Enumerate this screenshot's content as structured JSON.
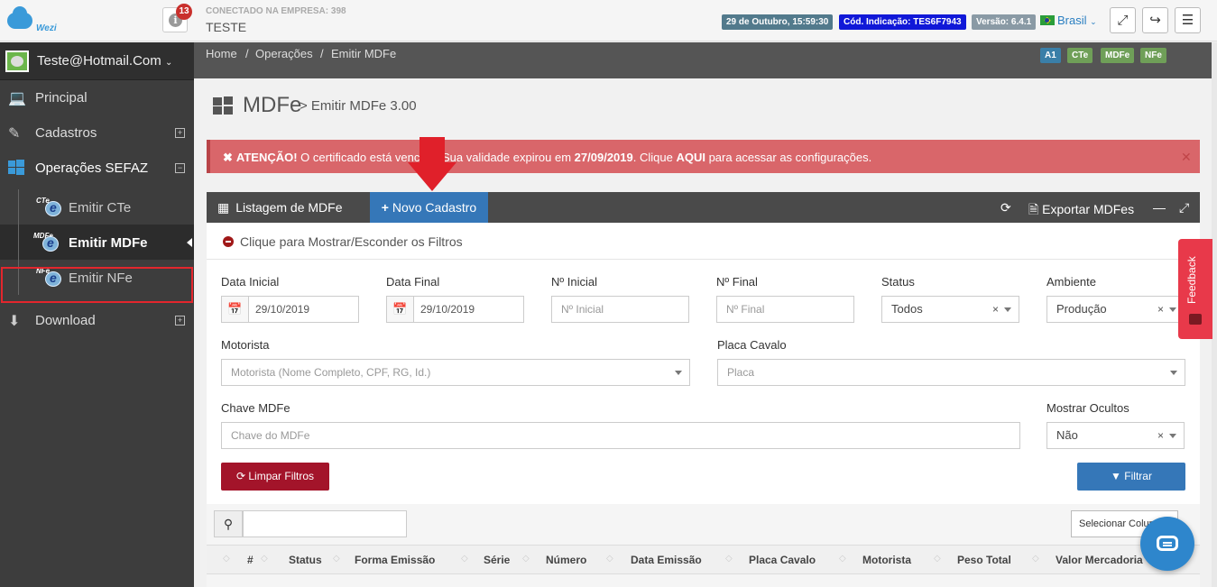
{
  "app": {
    "logo_text": "Wezi"
  },
  "topbar": {
    "notification_count": "13",
    "connected_label": "CONECTADO NA EMPRESA: 398",
    "company_name": "TESTE",
    "date_tag": "29 de Outubro, 15:59:30",
    "indication_tag": "Cód. Indicação: TES6F7943",
    "version_tag": "Versão: 6.4.1",
    "language": "Brasil",
    "icons": [
      "expand-icon",
      "logout-icon",
      "menu-icon"
    ]
  },
  "sidebar": {
    "user": "Teste@Hotmail.Com",
    "items": [
      {
        "label": "Principal",
        "icon": "laptop-icon"
      },
      {
        "label": "Cadastros",
        "icon": "edit-icon"
      },
      {
        "label": "Operações SEFAZ",
        "icon": "windows-icon"
      },
      {
        "label": "Download",
        "icon": "download-icon"
      }
    ],
    "sub_items": [
      {
        "label": "Emitir CTe",
        "tag": "CTe"
      },
      {
        "label": "Emitir MDFe",
        "tag": "MDFe"
      },
      {
        "label": "Emitir NFe",
        "tag": "NFe"
      }
    ]
  },
  "breadcrumb": {
    "items": [
      "Home",
      "Operações",
      "Emitir MDFe"
    ],
    "separator": "/",
    "badges": [
      {
        "label": "A1",
        "color": "#3a7fa8"
      },
      {
        "label": "CTe",
        "color": "#6f9f58"
      },
      {
        "label": "MDFe",
        "color": "#6f9f58"
      },
      {
        "label": "NFe",
        "color": "#6f9f58"
      }
    ]
  },
  "page": {
    "title": "MDFe",
    "subtitle": "> Emitir MDFe  3.00"
  },
  "alert": {
    "strong": "ATENÇÃO!",
    "text_1": " O certificado está vencido. Sua validade expirou em ",
    "date": "27/09/2019",
    "text_2": ". Clique ",
    "link": "AQUI",
    "text_3": " para acessar as configurações."
  },
  "panel": {
    "title": "Listagem de MDFe",
    "new_button": "Novo Cadastro",
    "export_button": "Exportar MDFes",
    "filter_toggle": "Clique para Mostrar/Esconder os Filtros"
  },
  "filters": {
    "data_inicial": {
      "label": "Data Inicial",
      "value": "29/10/2019"
    },
    "data_final": {
      "label": "Data Final",
      "value": "29/10/2019"
    },
    "n_inicial": {
      "label": "Nº Inicial",
      "placeholder": "Nº Inicial"
    },
    "n_final": {
      "label": "Nº Final",
      "placeholder": "Nº Final"
    },
    "status": {
      "label": "Status",
      "value": "Todos"
    },
    "ambiente": {
      "label": "Ambiente",
      "value": "Produção"
    },
    "motorista": {
      "label": "Motorista",
      "placeholder": "Motorista (Nome Completo, CPF, RG, Id.)"
    },
    "placa": {
      "label": "Placa Cavalo",
      "placeholder": "Placa"
    },
    "chave": {
      "label": "Chave MDFe",
      "placeholder": "Chave do MDFe"
    },
    "ocultos": {
      "label": "Mostrar Ocultos",
      "value": "Não"
    },
    "clear_button": "Limpar Filtros",
    "filter_button": "Filtrar"
  },
  "table": {
    "select_columns": "Selecionar Colunas",
    "columns": [
      "#",
      "Status",
      "Forma Emissão",
      "Série",
      "Número",
      "Data Emissão",
      "Placa Cavalo",
      "Motorista",
      "Peso Total",
      "Valor Mercadoria"
    ]
  },
  "feedback": {
    "label": "Feedback"
  }
}
